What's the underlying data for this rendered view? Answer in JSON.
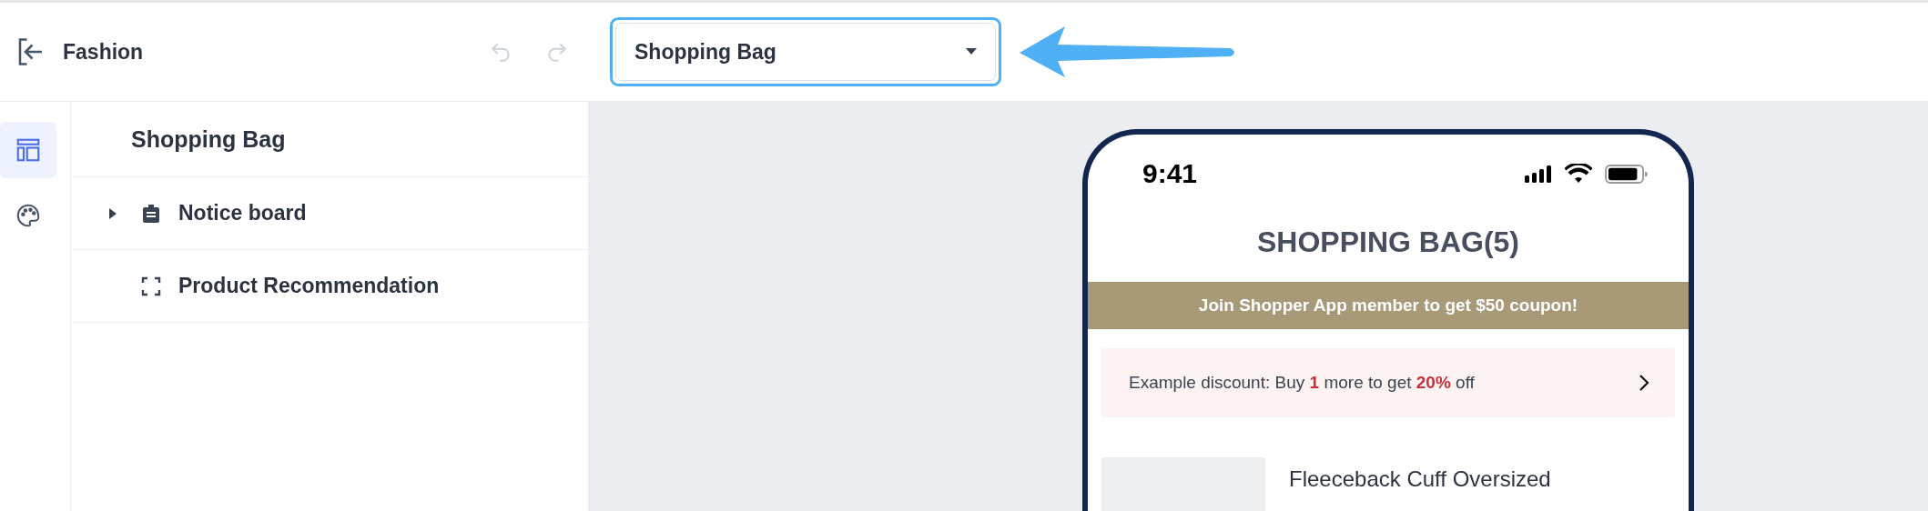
{
  "header": {
    "back_label": "Fashion",
    "undo": {
      "disabled": true
    },
    "redo": {
      "disabled": true
    }
  },
  "page_select": {
    "value": "Shopping Bag",
    "highlighted": true
  },
  "rail": [
    {
      "kind": "layout",
      "selected": true
    },
    {
      "kind": "palette",
      "selected": false
    }
  ],
  "panel": {
    "title": "Shopping Bag",
    "items": [
      {
        "label": "Notice board",
        "kind": "notice",
        "expanded": false
      },
      {
        "label": "Product Recommendation",
        "kind": "frame"
      }
    ]
  },
  "phone": {
    "time": "9:41",
    "title": "SHOPPING BAG(5)",
    "banner": "Join Shopper App member to get $50 coupon!",
    "discount": "Example discount: Buy **1** more to get **20%** off",
    "product": {
      "name": "Fleeceback Cuff Oversized"
    }
  }
}
